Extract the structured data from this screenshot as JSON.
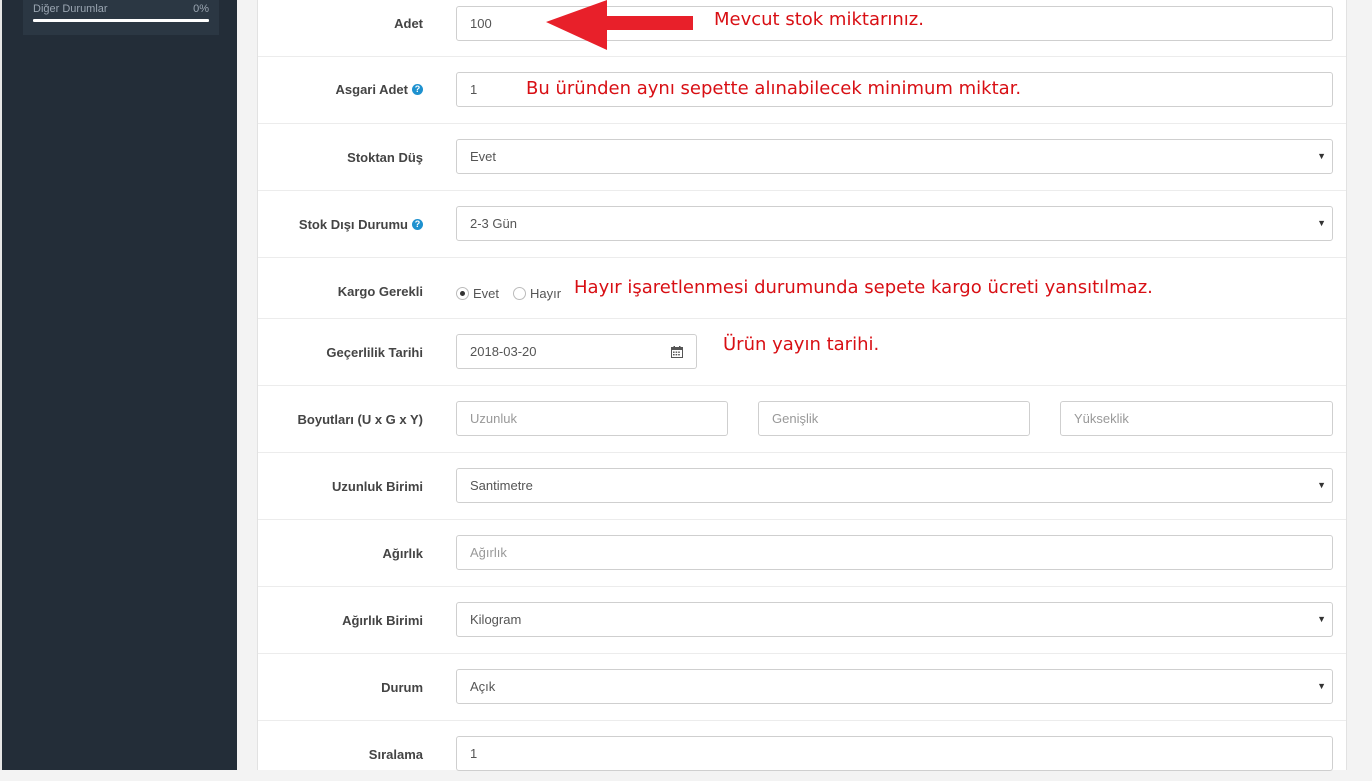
{
  "sidebar": {
    "stat": {
      "label": "Diğer Durumlar",
      "percent": "0%",
      "progress": 0
    }
  },
  "form": {
    "quantity": {
      "label": "Adet",
      "value": "100"
    },
    "minimum": {
      "label": "Asgari Adet",
      "value": "1",
      "help_icon": "question-circle-icon"
    },
    "subtract": {
      "label": "Stoktan Düş",
      "value": "Evet"
    },
    "stock_status": {
      "label": "Stok Dışı Durumu",
      "value": "2-3 Gün",
      "help_icon": "question-circle-icon"
    },
    "shipping": {
      "label": "Kargo Gerekli",
      "option_yes": "Evet",
      "option_no": "Hayır",
      "selected": "Evet"
    },
    "date_available": {
      "label": "Geçerlilik Tarihi",
      "value": "2018-03-20",
      "button_icon": "calendar-icon"
    },
    "dimensions": {
      "label": "Boyutları (U x G x Y)",
      "length_placeholder": "Uzunluk",
      "width_placeholder": "Genişlik",
      "height_placeholder": "Yükseklik"
    },
    "length_class": {
      "label": "Uzunluk Birimi",
      "value": "Santimetre"
    },
    "weight": {
      "label": "Ağırlık",
      "placeholder": "Ağırlık"
    },
    "weight_class": {
      "label": "Ağırlık Birimi",
      "value": "Kilogram"
    },
    "status": {
      "label": "Durum",
      "value": "Açık"
    },
    "sort_order": {
      "label": "Sıralama",
      "value": "1"
    }
  },
  "annotations": {
    "quantity_note": "Mevcut stok miktarınız.",
    "minimum_note": "Bu üründen aynı sepette alınabilecek minimum miktar.",
    "shipping_note": "Hayır işaretlenmesi durumunda sepete kargo ücreti yansıtılmaz.",
    "date_note": "Ürün yayın tarihi.",
    "arrow_color": "#e8202a",
    "text_color": "#d80f14"
  }
}
